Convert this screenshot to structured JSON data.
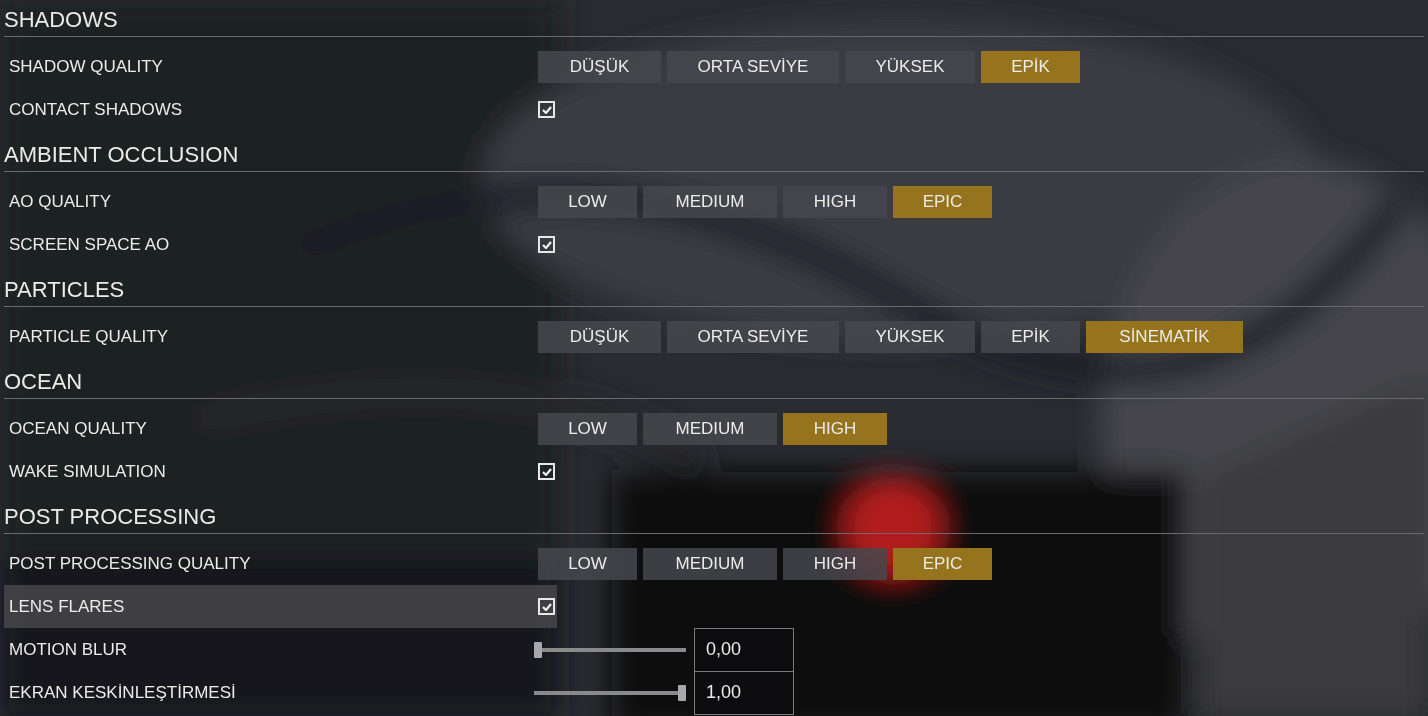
{
  "sections": [
    {
      "title": "SHADOWS",
      "rows": [
        {
          "kind": "options",
          "label": "SHADOW QUALITY",
          "highlighted": false,
          "options": [
            {
              "label": "DÜŞÜK",
              "selected": false
            },
            {
              "label": "ORTA SEVİYE",
              "selected": false
            },
            {
              "label": "YÜKSEK",
              "selected": false
            },
            {
              "label": "EPİK",
              "selected": true
            }
          ]
        },
        {
          "kind": "checkbox",
          "label": "CONTACT SHADOWS",
          "highlighted": false,
          "checked": true
        }
      ]
    },
    {
      "title": "AMBIENT OCCLUSION",
      "rows": [
        {
          "kind": "options",
          "label": "AO QUALITY",
          "highlighted": false,
          "options": [
            {
              "label": "LOW",
              "selected": false
            },
            {
              "label": "MEDIUM",
              "selected": false
            },
            {
              "label": "HIGH",
              "selected": false
            },
            {
              "label": "EPIC",
              "selected": true
            }
          ]
        },
        {
          "kind": "checkbox",
          "label": "SCREEN SPACE AO",
          "highlighted": false,
          "checked": true
        }
      ]
    },
    {
      "title": "PARTICLES",
      "rows": [
        {
          "kind": "options",
          "label": "PARTICLE QUALITY",
          "highlighted": false,
          "options": [
            {
              "label": "DÜŞÜK",
              "selected": false
            },
            {
              "label": "ORTA SEVİYE",
              "selected": false
            },
            {
              "label": "YÜKSEK",
              "selected": false
            },
            {
              "label": "EPİK",
              "selected": false
            },
            {
              "label": "SİNEMATİK",
              "selected": true
            }
          ]
        }
      ]
    },
    {
      "title": "OCEAN",
      "rows": [
        {
          "kind": "options",
          "label": "OCEAN QUALITY",
          "highlighted": false,
          "options": [
            {
              "label": "LOW",
              "selected": false
            },
            {
              "label": "MEDIUM",
              "selected": false
            },
            {
              "label": "HIGH",
              "selected": true
            }
          ]
        },
        {
          "kind": "checkbox",
          "label": "WAKE SIMULATION",
          "highlighted": false,
          "checked": true
        }
      ]
    },
    {
      "title": "POST PROCESSING",
      "rows": [
        {
          "kind": "options",
          "label": "POST PROCESSING QUALITY",
          "highlighted": false,
          "options": [
            {
              "label": "LOW",
              "selected": false
            },
            {
              "label": "MEDIUM",
              "selected": false
            },
            {
              "label": "HIGH",
              "selected": false
            },
            {
              "label": "EPIC",
              "selected": true
            }
          ]
        },
        {
          "kind": "checkbox",
          "label": "LENS FLARES",
          "highlighted": true,
          "checked": true
        },
        {
          "kind": "slider",
          "label": "MOTION BLUR",
          "highlighted": false,
          "level": 0,
          "value": "0,00"
        },
        {
          "kind": "slider",
          "label": "EKRAN KESKİNLEŞTİRMESİ",
          "highlighted": false,
          "level": 1,
          "value": "1,00"
        }
      ]
    }
  ]
}
